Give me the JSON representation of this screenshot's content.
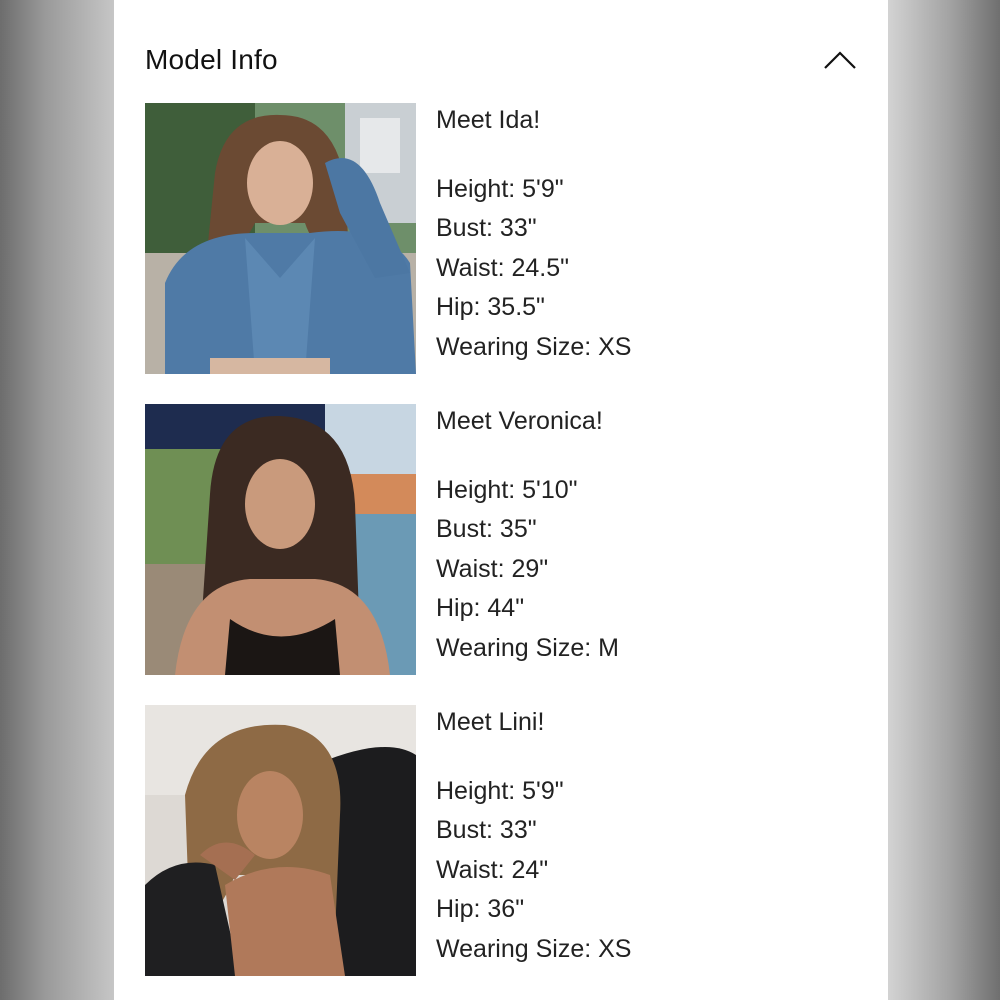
{
  "section": {
    "title": "Model Info",
    "toggle_icon": "chevron-up-icon"
  },
  "models": [
    {
      "intro": "Meet Ida!",
      "height": "Height: 5'9\"",
      "bust": "Bust: 33\"",
      "waist": "Waist: 24.5\"",
      "hip": "Hip: 35.5\"",
      "size": "Wearing Size: XS",
      "photo_desc_icon": "model-photo-ida"
    },
    {
      "intro": "Meet Veronica!",
      "height": "Height: 5'10\"",
      "bust": "Bust: 35\"",
      "waist": "Waist: 29\"",
      "hip": "Hip: 44\"",
      "size": "Wearing Size: M",
      "photo_desc_icon": "model-photo-veronica"
    },
    {
      "intro": "Meet Lini!",
      "height": "Height: 5'9\"",
      "bust": "Bust: 33\"",
      "waist": "Waist: 24\"",
      "hip": "Hip: 36\"",
      "size": "Wearing Size: XS",
      "photo_desc_icon": "model-photo-lini"
    }
  ],
  "colors": {
    "panel_bg": "#ffffff",
    "text": "#222222",
    "side_bg": "#9a9a9a"
  }
}
